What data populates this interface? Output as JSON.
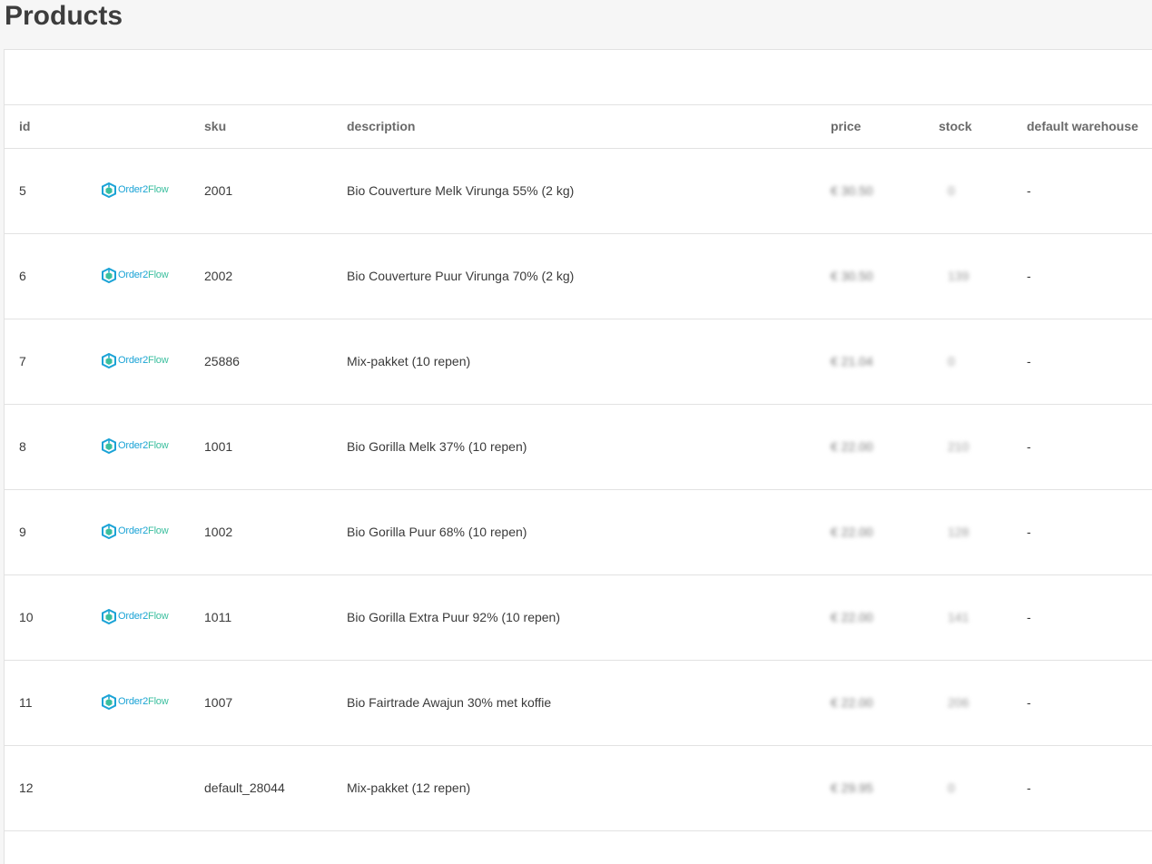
{
  "page": {
    "title": "Products"
  },
  "table": {
    "columns": {
      "id": "id",
      "logo": "",
      "sku": "sku",
      "description": "description",
      "price": "price",
      "stock": "stock",
      "warehouse": "default warehouse"
    },
    "rows": [
      {
        "id": "5",
        "has_logo": true,
        "sku": "2001",
        "description": "Bio Couverture Melk Virunga 55% (2 kg)",
        "price": "€ 30.50",
        "stock": "0",
        "warehouse": "-"
      },
      {
        "id": "6",
        "has_logo": true,
        "sku": "2002",
        "description": "Bio Couverture Puur Virunga 70% (2 kg)",
        "price": "€ 30.50",
        "stock": "139",
        "warehouse": "-"
      },
      {
        "id": "7",
        "has_logo": true,
        "sku": "25886",
        "description": "Mix-pakket (10 repen)",
        "price": "€ 21.04",
        "stock": "0",
        "warehouse": "-"
      },
      {
        "id": "8",
        "has_logo": true,
        "sku": "1001",
        "description": "Bio Gorilla Melk 37% (10 repen)",
        "price": "€ 22.00",
        "stock": "210",
        "warehouse": "-"
      },
      {
        "id": "9",
        "has_logo": true,
        "sku": "1002",
        "description": "Bio Gorilla Puur 68% (10 repen)",
        "price": "€ 22.00",
        "stock": "128",
        "warehouse": "-"
      },
      {
        "id": "10",
        "has_logo": true,
        "sku": "1011",
        "description": "Bio Gorilla Extra Puur 92% (10 repen)",
        "price": "€ 22.00",
        "stock": "141",
        "warehouse": "-"
      },
      {
        "id": "11",
        "has_logo": true,
        "sku": "1007",
        "description": "Bio Fairtrade Awajun 30% met koffie",
        "price": "€ 22.00",
        "stock": "206",
        "warehouse": "-"
      },
      {
        "id": "12",
        "has_logo": false,
        "sku": "default_28044",
        "description": "Mix-pakket (12 repen)",
        "price": "€ 29.95",
        "stock": "0",
        "warehouse": "-"
      }
    ]
  },
  "logo": {
    "part1": "Order2",
    "part2": "Flow",
    "color1": "#1aa3d6",
    "color2": "#3bbf9e"
  }
}
